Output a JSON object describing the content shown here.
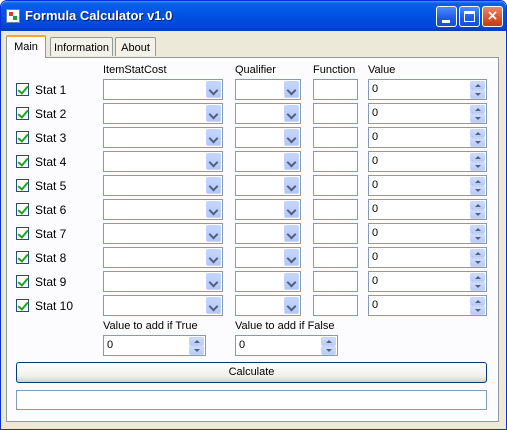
{
  "window": {
    "title": "Formula Calculator v1.0",
    "controls": {
      "minimize": "minimize",
      "maximize": "maximize",
      "close": "×"
    }
  },
  "tabs": [
    {
      "label": "Main",
      "active": true
    },
    {
      "label": "Information",
      "active": false
    },
    {
      "label": "About",
      "active": false
    }
  ],
  "columns": {
    "itemstatcost": "ItemStatCost",
    "qualifier": "Qualifier",
    "function": "Function",
    "value": "Value"
  },
  "rows": [
    {
      "label": "Stat 1",
      "checked": true,
      "itemstatcost": "",
      "qualifier": "",
      "function": "",
      "value": "0"
    },
    {
      "label": "Stat 2",
      "checked": true,
      "itemstatcost": "",
      "qualifier": "",
      "function": "",
      "value": "0"
    },
    {
      "label": "Stat 3",
      "checked": true,
      "itemstatcost": "",
      "qualifier": "",
      "function": "",
      "value": "0"
    },
    {
      "label": "Stat 4",
      "checked": true,
      "itemstatcost": "",
      "qualifier": "",
      "function": "",
      "value": "0"
    },
    {
      "label": "Stat 5",
      "checked": true,
      "itemstatcost": "",
      "qualifier": "",
      "function": "",
      "value": "0"
    },
    {
      "label": "Stat 6",
      "checked": true,
      "itemstatcost": "",
      "qualifier": "",
      "function": "",
      "value": "0"
    },
    {
      "label": "Stat 7",
      "checked": true,
      "itemstatcost": "",
      "qualifier": "",
      "function": "",
      "value": "0"
    },
    {
      "label": "Stat 8",
      "checked": true,
      "itemstatcost": "",
      "qualifier": "",
      "function": "",
      "value": "0"
    },
    {
      "label": "Stat 9",
      "checked": true,
      "itemstatcost": "",
      "qualifier": "",
      "function": "",
      "value": "0"
    },
    {
      "label": "Stat 10",
      "checked": true,
      "itemstatcost": "",
      "qualifier": "",
      "function": "",
      "value": "0"
    }
  ],
  "value_if_true": {
    "label": "Value to add if True",
    "value": "0"
  },
  "value_if_false": {
    "label": "Value to add if False",
    "value": "0"
  },
  "calculate_label": "Calculate",
  "result": ""
}
